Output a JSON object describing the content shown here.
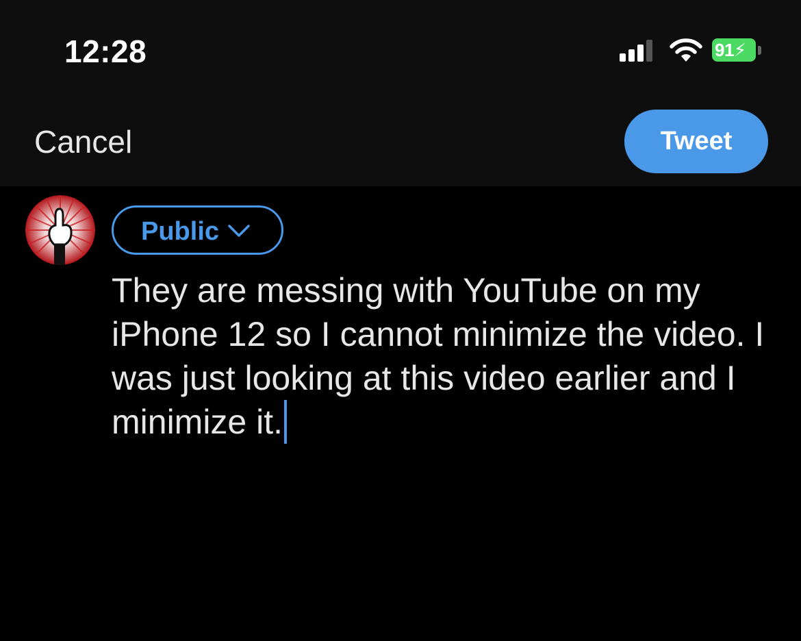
{
  "status_bar": {
    "time": "12:28",
    "battery_level": "91",
    "battery_charging": true,
    "cellular_bars_filled": 3,
    "cellular_bars_total": 4,
    "battery_color": "#4cd964"
  },
  "nav": {
    "cancel_label": "Cancel",
    "tweet_label": "Tweet",
    "accent_color": "#4a99e9"
  },
  "compose": {
    "audience_label": "Public",
    "text": "They are messing with YouTube on my iPhone 12 so I cannot minimize the video. I was just looking at this video earlier and I minimize it."
  },
  "icons": {
    "signal": "cellular-signal-icon",
    "wifi": "wifi-icon",
    "battery": "battery-charging-icon",
    "chevron": "chevron-down-icon",
    "avatar": "profile-avatar"
  }
}
